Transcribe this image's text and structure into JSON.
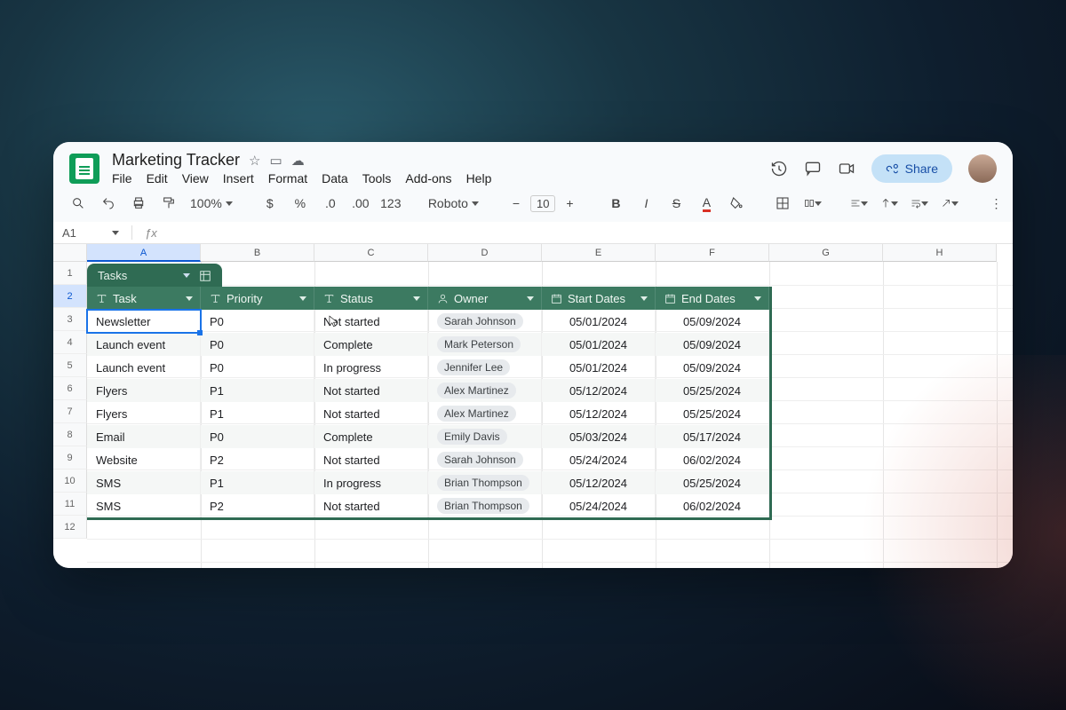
{
  "document": {
    "title": "Marketing Tracker"
  },
  "menubar": [
    "File",
    "Edit",
    "View",
    "Insert",
    "Format",
    "Data",
    "Tools",
    "Add-ons",
    "Help"
  ],
  "toolbar": {
    "zoom": "100%",
    "font": "Roboto",
    "fontsize": "10"
  },
  "share_label": "Share",
  "namebox": {
    "cell": "A1"
  },
  "columns": [
    "A",
    "B",
    "C",
    "D",
    "E",
    "F",
    "G",
    "H"
  ],
  "selected_column_index": 0,
  "row_numbers": [
    1,
    2,
    3,
    4,
    5,
    6,
    7,
    8,
    9,
    10,
    11,
    12
  ],
  "selected_row_index": 1,
  "table": {
    "name": "Tasks",
    "headers": [
      {
        "label": "Task",
        "type": "text"
      },
      {
        "label": "Priority",
        "type": "text"
      },
      {
        "label": "Status",
        "type": "text"
      },
      {
        "label": "Owner",
        "type": "person"
      },
      {
        "label": "Start Dates",
        "type": "date"
      },
      {
        "label": "End Dates",
        "type": "date"
      }
    ],
    "rows": [
      {
        "task": "Newsletter",
        "priority": "P0",
        "status": "Not started",
        "owner": "Sarah Johnson",
        "start": "05/01/2024",
        "end": "05/09/2024"
      },
      {
        "task": "Launch event",
        "priority": "P0",
        "status": "Complete",
        "owner": "Mark Peterson",
        "start": "05/01/2024",
        "end": "05/09/2024"
      },
      {
        "task": "Launch event",
        "priority": "P0",
        "status": "In progress",
        "owner": "Jennifer Lee",
        "start": "05/01/2024",
        "end": "05/09/2024"
      },
      {
        "task": "Flyers",
        "priority": "P1",
        "status": "Not started",
        "owner": "Alex Martinez",
        "start": "05/12/2024",
        "end": "05/25/2024"
      },
      {
        "task": "Flyers",
        "priority": "P1",
        "status": "Not started",
        "owner": "Alex Martinez",
        "start": "05/12/2024",
        "end": "05/25/2024"
      },
      {
        "task": "Email",
        "priority": "P0",
        "status": "Complete",
        "owner": "Emily Davis",
        "start": "05/03/2024",
        "end": "05/17/2024"
      },
      {
        "task": "Website",
        "priority": "P2",
        "status": "Not started",
        "owner": "Sarah Johnson",
        "start": "05/24/2024",
        "end": "06/02/2024"
      },
      {
        "task": "SMS",
        "priority": "P1",
        "status": "In progress",
        "owner": "Brian Thompson",
        "start": "05/12/2024",
        "end": "05/25/2024"
      },
      {
        "task": "SMS",
        "priority": "P2",
        "status": "Not started",
        "owner": "Brian Thompson",
        "start": "05/24/2024",
        "end": "06/02/2024"
      }
    ]
  },
  "colors": {
    "table_header": "#3c7a61",
    "table_tab": "#2f6b53",
    "selection": "#1a73e8"
  }
}
